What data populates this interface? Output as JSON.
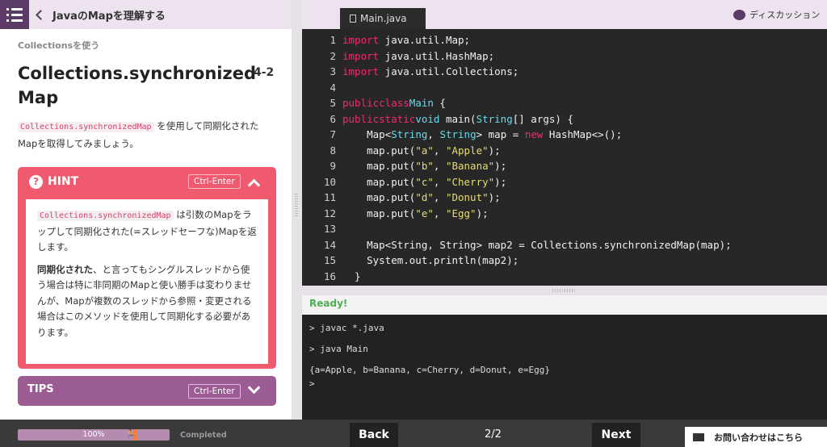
{
  "header": {
    "lesson_title": "JavaのMapを理解する"
  },
  "breadcrumb": "Collectionsを使う",
  "exercise": {
    "title": "Collections.synchronized Map",
    "number": "4-2",
    "desc_code": "Collections.synchronizedMap",
    "desc_text": "を使用して同期化されたMapを取得してみましょう。"
  },
  "hint": {
    "label": "HINT",
    "shortcut": "Ctrl-Enter",
    "code": "Collections.synchronizedMap",
    "p1": "は引数のMapをラップして同期化された(=スレッドセーフな)Mapを返します。",
    "p2_bold": "同期化された",
    "p2": "、と言ってもシングルスレッドから使う場合は特に非同期のMapと使い勝手は変わりませんが、Mapが複数のスレッドから参照・変更される場合はこのメソッドを使用して同期化する必要があります。"
  },
  "tips": {
    "label": "TIPS",
    "shortcut": "Ctrl-Enter"
  },
  "editor": {
    "tab": "Main.java",
    "discussion": "ディスカッション",
    "line_numbers": [
      "1",
      "2",
      "3",
      "4",
      "5",
      "6",
      "7",
      "8",
      "9",
      "10",
      "11",
      "12",
      "13",
      "14",
      "15",
      "16"
    ]
  },
  "status": "Ready!",
  "console": {
    "lines": [
      "> javac *.java",
      "> java Main",
      "{a=Apple, b=Banana, c=Cherry, d=Donut, e=Egg}",
      ">"
    ]
  },
  "footer": {
    "progress_text": "100%",
    "progress": 1.0,
    "completed": "Completed",
    "back": "Back",
    "page": "2/2",
    "next": "Next",
    "contact": "お問い合わせはこちら"
  }
}
